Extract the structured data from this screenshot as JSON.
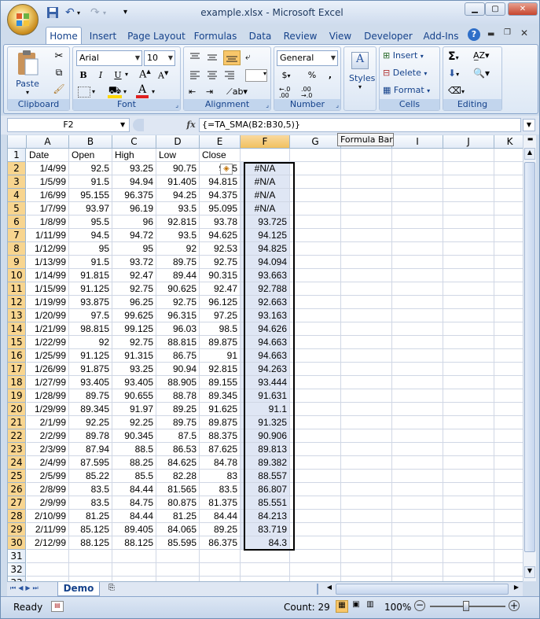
{
  "window": {
    "title": "example.xlsx - Microsoft Excel"
  },
  "tabs": [
    "Home",
    "Insert",
    "Page Layout",
    "Formulas",
    "Data",
    "Review",
    "View",
    "Developer",
    "Add-Ins"
  ],
  "ribbon": {
    "clipboard": {
      "label": "Clipboard",
      "paste": "Paste"
    },
    "font": {
      "label": "Font",
      "font_name": "Arial",
      "font_size": "10",
      "bold": "B",
      "italic": "I",
      "underline": "U"
    },
    "alignment": {
      "label": "Alignment"
    },
    "number": {
      "label": "Number",
      "format": "General",
      "currency": "$",
      "percent": "%",
      "comma": ","
    },
    "styles": {
      "label": "Styles"
    },
    "cells": {
      "label": "Cells",
      "insert": "Insert",
      "delete": "Delete",
      "format": "Format"
    },
    "editing": {
      "label": "Editing"
    }
  },
  "formula_bar": {
    "name_box": "F2",
    "fx": "fx",
    "formula": "{=TA_SMA(B2:B30,5)}",
    "tooltip": "Formula Bar"
  },
  "columns": [
    "A",
    "B",
    "C",
    "D",
    "E",
    "F",
    "G",
    "H",
    "I",
    "J",
    "K"
  ],
  "rows": [
    [
      "Date",
      "Open",
      "High",
      "Low",
      "Close",
      ""
    ],
    [
      "1/4/99",
      "92.5",
      "93.25",
      "90.75",
      "92.5",
      "#N/A"
    ],
    [
      "1/5/99",
      "91.5",
      "94.94",
      "91.405",
      "94.815",
      "#N/A"
    ],
    [
      "1/6/99",
      "95.155",
      "96.375",
      "94.25",
      "94.375",
      "#N/A"
    ],
    [
      "1/7/99",
      "93.97",
      "96.19",
      "93.5",
      "95.095",
      "#N/A"
    ],
    [
      "1/8/99",
      "95.5",
      "96",
      "92.815",
      "93.78",
      "93.725"
    ],
    [
      "1/11/99",
      "94.5",
      "94.72",
      "93.5",
      "94.625",
      "94.125"
    ],
    [
      "1/12/99",
      "95",
      "95",
      "92",
      "92.53",
      "94.825"
    ],
    [
      "1/13/99",
      "91.5",
      "93.72",
      "89.75",
      "92.75",
      "94.094"
    ],
    [
      "1/14/99",
      "91.815",
      "92.47",
      "89.44",
      "90.315",
      "93.663"
    ],
    [
      "1/15/99",
      "91.125",
      "92.75",
      "90.625",
      "92.47",
      "92.788"
    ],
    [
      "1/19/99",
      "93.875",
      "96.25",
      "92.75",
      "96.125",
      "92.663"
    ],
    [
      "1/20/99",
      "97.5",
      "99.625",
      "96.315",
      "97.25",
      "93.163"
    ],
    [
      "1/21/99",
      "98.815",
      "99.125",
      "96.03",
      "98.5",
      "94.626"
    ],
    [
      "1/22/99",
      "92",
      "92.75",
      "88.815",
      "89.875",
      "94.663"
    ],
    [
      "1/25/99",
      "91.125",
      "91.315",
      "86.75",
      "91",
      "94.663"
    ],
    [
      "1/26/99",
      "91.875",
      "93.25",
      "90.94",
      "92.815",
      "94.263"
    ],
    [
      "1/27/99",
      "93.405",
      "93.405",
      "88.905",
      "89.155",
      "93.444"
    ],
    [
      "1/28/99",
      "89.75",
      "90.655",
      "88.78",
      "89.345",
      "91.631"
    ],
    [
      "1/29/99",
      "89.345",
      "91.97",
      "89.25",
      "91.625",
      "91.1"
    ],
    [
      "2/1/99",
      "92.25",
      "92.25",
      "89.75",
      "89.875",
      "91.325"
    ],
    [
      "2/2/99",
      "89.78",
      "90.345",
      "87.5",
      "88.375",
      "90.906"
    ],
    [
      "2/3/99",
      "87.94",
      "88.5",
      "86.53",
      "87.625",
      "89.813"
    ],
    [
      "2/4/99",
      "87.595",
      "88.25",
      "84.625",
      "84.78",
      "89.382"
    ],
    [
      "2/5/99",
      "85.22",
      "85.5",
      "82.28",
      "83",
      "88.557"
    ],
    [
      "2/8/99",
      "83.5",
      "84.44",
      "81.565",
      "83.5",
      "86.807"
    ],
    [
      "2/9/99",
      "83.5",
      "84.75",
      "80.875",
      "81.375",
      "85.551"
    ],
    [
      "2/10/99",
      "81.25",
      "84.44",
      "81.25",
      "84.44",
      "84.213"
    ],
    [
      "2/11/99",
      "85.125",
      "89.405",
      "84.065",
      "89.25",
      "83.719"
    ],
    [
      "2/12/99",
      "88.125",
      "88.125",
      "85.595",
      "86.375",
      "84.3"
    ],
    [
      "",
      "",
      "",
      "",
      "",
      ""
    ],
    [
      "",
      "",
      "",
      "",
      "",
      ""
    ],
    [
      "",
      "",
      "",
      "",
      "",
      ""
    ]
  ],
  "sheet_tabs": [
    "Demo"
  ],
  "status": {
    "ready": "Ready",
    "count": "Count: 29",
    "zoom": "100%"
  }
}
